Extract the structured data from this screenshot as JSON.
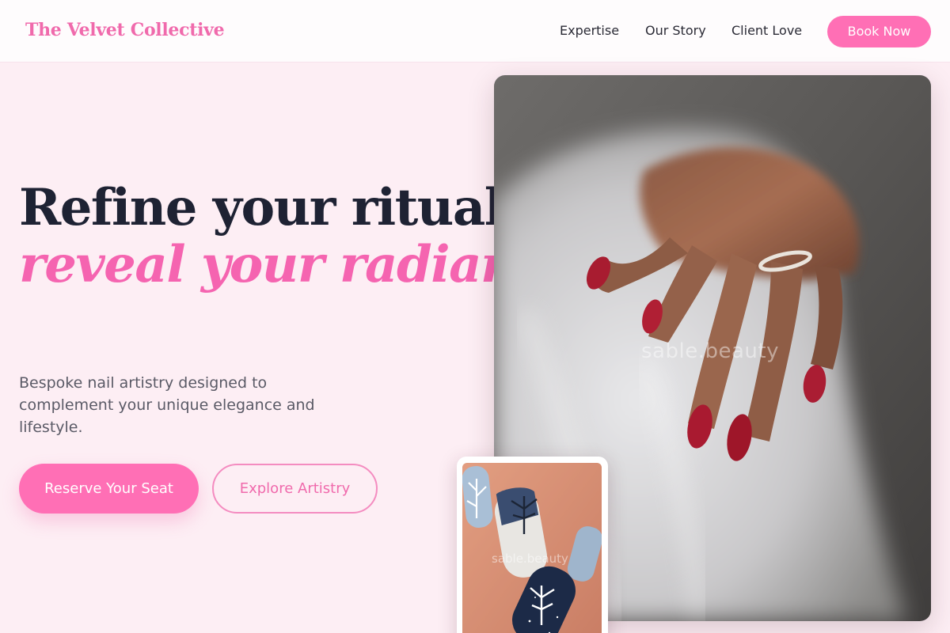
{
  "nav": {
    "brand": "The Velvet Collective",
    "links": [
      "Expertise",
      "Our Story",
      "Client Love"
    ],
    "cta": "Book Now"
  },
  "hero": {
    "headline_line1": "Refine your ritual,",
    "headline_line2": "reveal your radiance.",
    "subtext": "Bespoke nail artistry designed to complement your unique elegance and lifestyle.",
    "primary_button": "Reserve Your Seat",
    "secondary_button": "Explore Artistry"
  },
  "images": {
    "hero_watermark": "sable.beauty",
    "inset_watermark": "sable.beauty"
  },
  "colors": {
    "accent_pink": "#ff6fb5",
    "brand_pink": "#f06aac",
    "page_background": "#fdeef4",
    "headline_dark": "#1e2233"
  }
}
